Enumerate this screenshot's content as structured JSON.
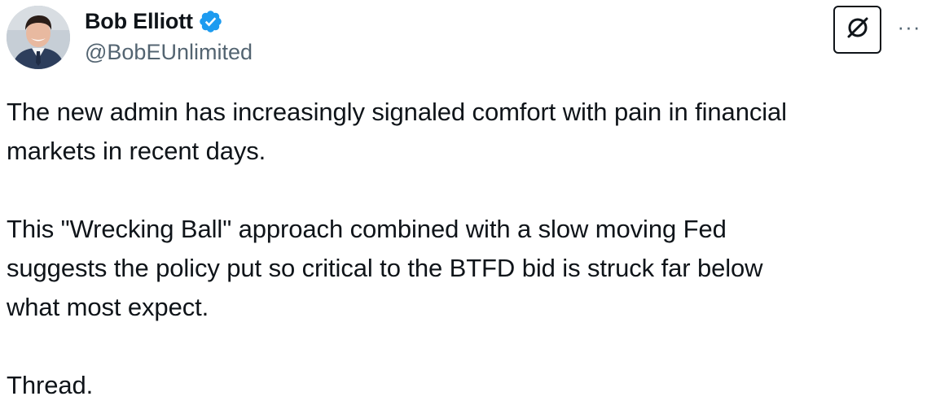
{
  "author": {
    "display_name": "Bob Elliott",
    "handle": "@BobEUnlimited",
    "avatar_icon": "avatar-photo",
    "verified_icon": "verified-badge-icon"
  },
  "actions": {
    "grok_icon": "grok-icon",
    "more_label": "···"
  },
  "colors": {
    "verified_blue": "#1d9bf0",
    "text": "#0f1419",
    "secondary": "#536471"
  },
  "tweet": {
    "paragraphs": [
      "The new admin has increasingly signaled comfort with pain in financial\nmarkets in recent days.",
      "This \"Wrecking Ball\" approach combined with a slow moving Fed\nsuggests the policy put so critical to the BTFD bid is struck far below\nwhat most expect.",
      "Thread."
    ]
  }
}
